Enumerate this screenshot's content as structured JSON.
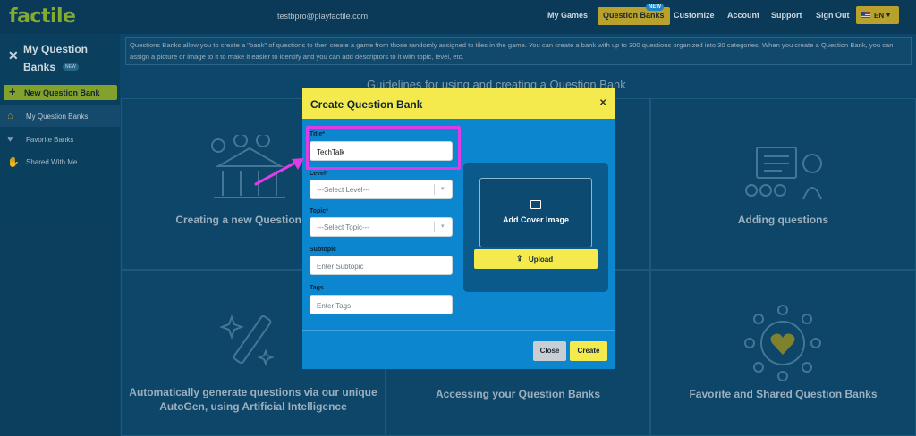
{
  "header": {
    "logo": "factile",
    "email": "testbpro@playfactile.com",
    "nav": [
      "My Games",
      "Question Banks",
      "Customize",
      "Account",
      "Support",
      "Sign Out"
    ],
    "nav_badge": "NEW",
    "language": "EN"
  },
  "sidebar": {
    "title": "My Question Banks",
    "title_badge": "NEW",
    "new_bank_label": "New Question Bank",
    "items": [
      {
        "label": "My Question Banks",
        "icon": "home-icon"
      },
      {
        "label": "Favorite Banks",
        "icon": "heart-icon"
      },
      {
        "label": "Shared With Me",
        "icon": "handshake-icon"
      }
    ]
  },
  "main": {
    "banner": "Questions Banks allow you to create a \"bank\" of questions to then create a game from those randomly assigned to tiles in the game. You can create a bank with up to 300 questions organized into 30 categories. When you create a Question Bank, you can assign a picture or image to it to make it easier to identify and you can add descriptors to it with topic, level, etc.",
    "guidelines_title": "Guidelines for using and creating a Question Bank",
    "cards": [
      "Creating a new Question Bank",
      "Adding questions",
      "Automatically generate questions via our unique AutoGen, using Artificial Intelligence",
      "Accessing your Question Banks",
      "Favorite and Shared Question Banks"
    ]
  },
  "modal": {
    "title": "Create Question Bank",
    "title_label": "Title*",
    "title_value": "TechTalk",
    "level_label": "Level*",
    "level_value": "---Select Level---",
    "topic_label": "Topic*",
    "topic_value": "---Select Topic---",
    "subtopic_label": "Subtopic",
    "subtopic_placeholder": "Enter Subtopic",
    "tags_label": "Tags",
    "tags_placeholder": "Enter Tags",
    "cover_label": "Add Cover Image",
    "upload_label": "Upload",
    "close_label": "Close",
    "create_label": "Create"
  },
  "colors": {
    "accent_yellow": "#f4ea4d",
    "modal_blue": "#0b86cf",
    "highlight_magenta": "#dd3ce6",
    "brand_green": "#8db832"
  }
}
